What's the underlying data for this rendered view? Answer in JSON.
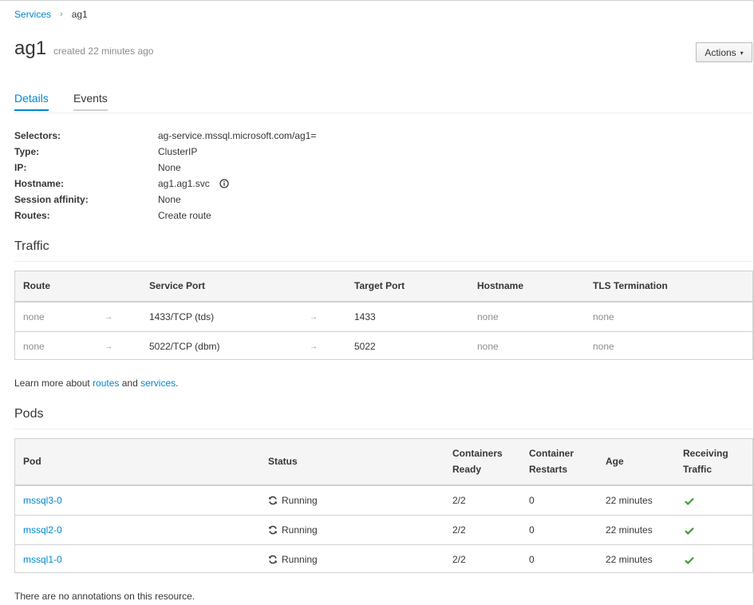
{
  "breadcrumb": {
    "parent": "Services",
    "separator": "›",
    "current": "ag1"
  },
  "header": {
    "title": "ag1",
    "created": "created 22 minutes ago",
    "actions_label": "Actions",
    "actions_caret": "▾"
  },
  "tabs": [
    {
      "label": "Details"
    },
    {
      "label": "Events"
    }
  ],
  "details": {
    "selectors_label": "Selectors:",
    "selectors_value": "ag-service.mssql.microsoft.com/ag1=",
    "type_label": "Type:",
    "type_value": "ClusterIP",
    "ip_label": "IP:",
    "ip_value": "None",
    "hostname_label": "Hostname:",
    "hostname_value": "ag1.ag1.svc",
    "affinity_label": "Session affinity:",
    "affinity_value": "None",
    "routes_label": "Routes:",
    "routes_value": "Create route"
  },
  "traffic": {
    "title": "Traffic",
    "headers": {
      "route": "Route",
      "service_port": "Service Port",
      "target_port": "Target Port",
      "hostname": "Hostname",
      "tls": "TLS Termination"
    },
    "rows": [
      {
        "route": "none",
        "arrow1": "→",
        "service_port": "1433/TCP (tds)",
        "arrow2": "→",
        "target_port": "1433",
        "hostname": "none",
        "tls": "none"
      },
      {
        "route": "none",
        "arrow1": "→",
        "service_port": "5022/TCP (dbm)",
        "arrow2": "→",
        "target_port": "5022",
        "hostname": "none",
        "tls": "none"
      }
    ]
  },
  "learn_more": {
    "prefix": "Learn more about ",
    "routes_link": "routes",
    "and": " and ",
    "services_link": "services",
    "suffix": "."
  },
  "pods": {
    "title": "Pods",
    "headers": {
      "pod": "Pod",
      "status": "Status",
      "ready_1": "Containers",
      "ready_2": "Ready",
      "restarts_1": "Container",
      "restarts_2": "Restarts",
      "age": "Age",
      "traffic_1": "Receiving",
      "traffic_2": "Traffic"
    },
    "rows": [
      {
        "pod": "mssql3-0",
        "status": "Running",
        "ready": "2/2",
        "restarts": "0",
        "age": "22 minutes"
      },
      {
        "pod": "mssql2-0",
        "status": "Running",
        "ready": "2/2",
        "restarts": "0",
        "age": "22 minutes"
      },
      {
        "pod": "mssql1-0",
        "status": "Running",
        "ready": "2/2",
        "restarts": "0",
        "age": "22 minutes"
      }
    ]
  },
  "annotations_text": "There are no annotations on this resource.",
  "icons": {
    "status_running": "sync-icon",
    "receiving_traffic": "check-icon",
    "hostname_info": "info-icon"
  },
  "colors": {
    "link": "#0088ce",
    "check": "#3f9c35",
    "muted": "#8b8d8f"
  }
}
